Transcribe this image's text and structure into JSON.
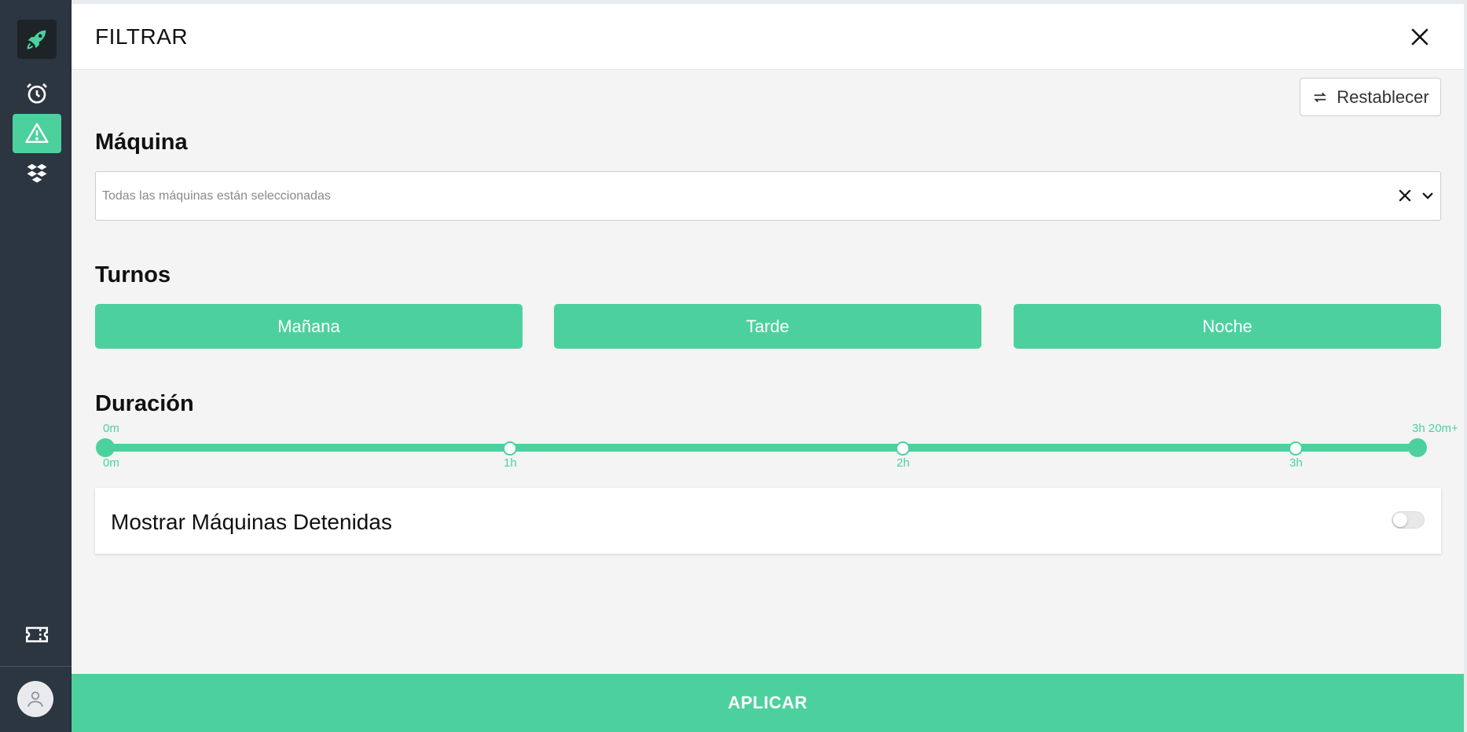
{
  "sidebar": {
    "logo": "rocket-icon",
    "items": [
      {
        "icon": "alarm-clock-icon",
        "active": false
      },
      {
        "icon": "warning-icon",
        "active": true
      },
      {
        "icon": "stack-icon",
        "active": false
      },
      {
        "icon": "ticket-icon",
        "active": false
      }
    ],
    "user": "user-icon"
  },
  "panel": {
    "title": "FILTRAR",
    "reset_label": "Restablecer",
    "apply_label": "APLICAR"
  },
  "machine": {
    "title": "Máquina",
    "placeholder": "Todas las máquinas están seleccionadas"
  },
  "shifts": {
    "title": "Turnos",
    "options": [
      "Mañana",
      "Tarde",
      "Noche"
    ]
  },
  "duration": {
    "title": "Duración",
    "min_label": "0m",
    "max_label": "3h 20m+",
    "ticks": [
      "0m",
      "1h",
      "2h",
      "3h"
    ],
    "range_minutes": [
      0,
      200
    ]
  },
  "stopped_toggle": {
    "label": "Mostrar Máquinas Detenidas",
    "enabled": false
  },
  "colors": {
    "accent": "#4cd19e",
    "sidebar": "#2c3640"
  }
}
